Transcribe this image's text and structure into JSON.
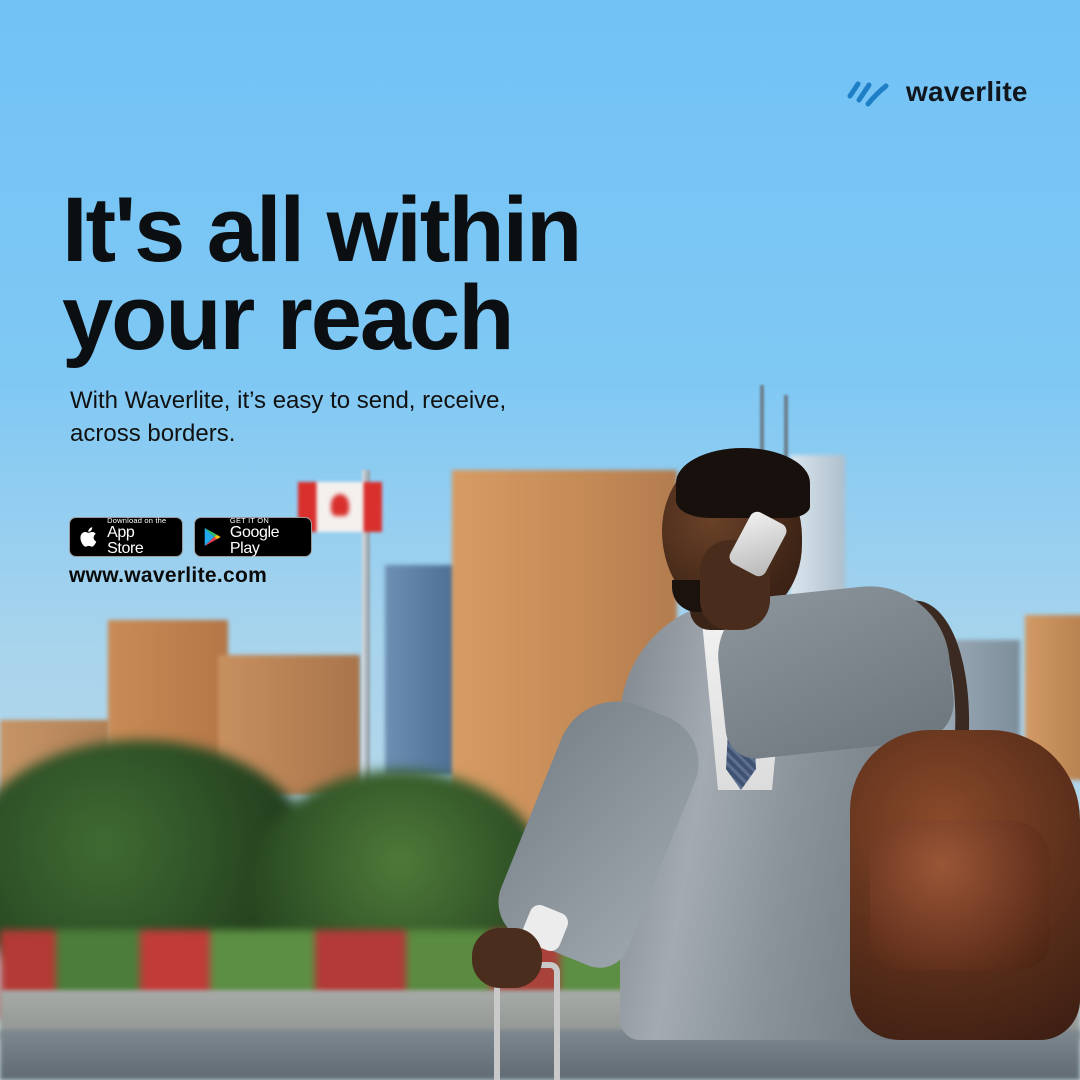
{
  "brand": {
    "name": "waverlite",
    "accent_color": "#1f7fc6",
    "icon": "waverlite-wave-logo"
  },
  "hero": {
    "headline_line1": "It's all within",
    "headline_line2": "your reach",
    "subtitle": "With Waverlite, it’s easy to send, receive, across borders."
  },
  "stores": {
    "apple": {
      "small": "Download on the",
      "big": "App Store",
      "icon": "apple-icon"
    },
    "google": {
      "small": "GET IT ON",
      "big": "Google Play",
      "icon": "google-play-icon"
    }
  },
  "website": "www.waverlite.com",
  "colors": {
    "sky": "#72c2f6",
    "text": "#0b0f12"
  }
}
